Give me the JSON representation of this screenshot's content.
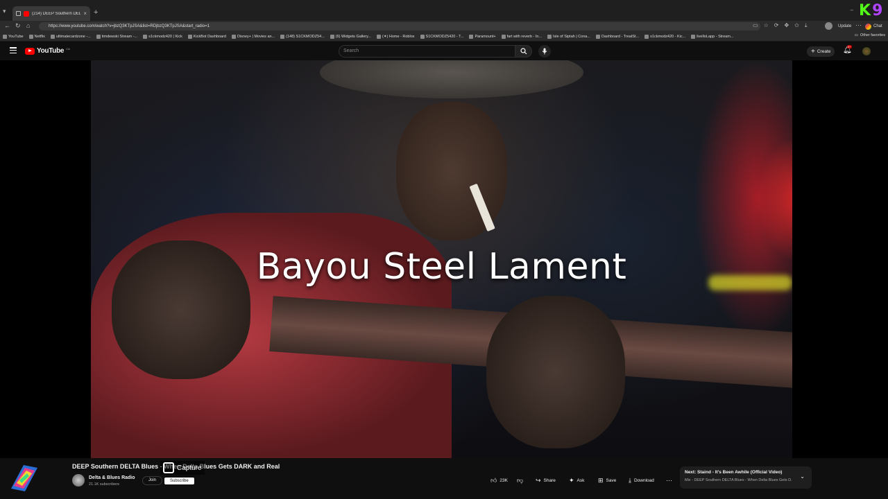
{
  "browser": {
    "tab_title": "(214) DEEP Southern DELTA",
    "url": "https://www.youtube.com/watch?v=jbzQ3KTpJSA&list=RDjbzQ3KTpJSA&start_radio=1",
    "update_label": "Update",
    "chat_label": "Chat",
    "other_favorites": "Other favorites",
    "bookmarks": [
      "YouTube",
      "Netflix",
      "ultimatecardzone -...",
      "timdewski Stream -...",
      "s1ckmodz420 | Kick",
      "KickBot Dashboard",
      "Disney+ | Movies an...",
      "(148) S1CKMODZ54...",
      "(6) Widgets Gallery...",
      "(✦) Home - Roblox",
      "S1CKMODZ5420 - T...",
      "Paramount+",
      "fart with reverb - In...",
      "Isle of Siptah | Cona...",
      "Dashboard - TreatSt...",
      "s1ckmodz420 - Kic...",
      "livelloLapp - Stream..."
    ]
  },
  "youtube": {
    "logo_text": "YouTube",
    "country": "CA",
    "search_placeholder": "Search",
    "create_label": "Create",
    "notif_count": "9+"
  },
  "video": {
    "overlay_title": "Bayou Steel Lament",
    "title": "DEEP Southern DELTA Blues - When Delta Blues Gets DARK and Real",
    "capture_label": "Capture"
  },
  "channel": {
    "name": "Delta & Blues Radio",
    "subscribers": "21.1K subscribers",
    "join_label": "Join",
    "subscribe_label": "Subscribe"
  },
  "actions": {
    "likes": "23K",
    "share": "Share",
    "ask": "Ask",
    "save": "Save",
    "download": "Download"
  },
  "up_next": {
    "line1": "Next: Staind - It's Been Awhile (Official Video)",
    "line2": "Mix - DEEP Southern DELTA Blues - When Delta Blues Gets D..."
  }
}
